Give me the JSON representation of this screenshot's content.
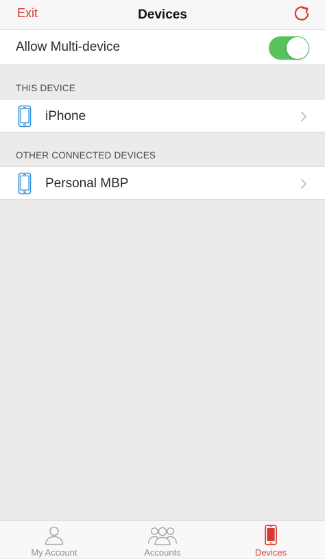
{
  "nav": {
    "exit_label": "Exit",
    "title": "Devices",
    "refresh_icon": "refresh-icon"
  },
  "multi_device": {
    "label": "Allow Multi-device",
    "enabled": true
  },
  "sections": [
    {
      "header": "THIS DEVICE",
      "devices": [
        {
          "name": "iPhone",
          "icon": "phone-icon"
        }
      ]
    },
    {
      "header": "OTHER CONNECTED DEVICES",
      "devices": [
        {
          "name": "Personal MBP",
          "icon": "phone-icon"
        }
      ]
    }
  ],
  "tabs": [
    {
      "label": "My Account",
      "icon": "person-icon",
      "active": false
    },
    {
      "label": "Accounts",
      "icon": "people-icon",
      "active": false
    },
    {
      "label": "Devices",
      "icon": "phone-icon",
      "active": true
    }
  ],
  "colors": {
    "accent": "#d63a30",
    "toggle_on": "#56c35d",
    "device_icon": "#2f8fd8",
    "tab_inactive": "#8e8e8e",
    "background": "#ebebeb"
  }
}
